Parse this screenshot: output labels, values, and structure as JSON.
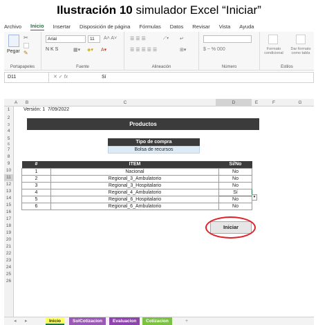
{
  "caption": {
    "bold": "Ilustración 10",
    "rest": " simulador Excel “Iniciar”"
  },
  "menu": [
    "Archivo",
    "Inicio",
    "Insertar",
    "Disposición de página",
    "Fórmulas",
    "Datos",
    "Revisar",
    "Vista",
    "Ayuda"
  ],
  "ribbon": {
    "paste_label": "Pegar",
    "font_name": "Arial",
    "font_size": "11",
    "font_format": "N K S",
    "number_format": "$ ~ % 000",
    "cond_format": "Formato condicional",
    "table_format": "Dar formato como tabla",
    "groups": [
      "Portapapeles",
      "Fuente",
      "Alineación",
      "Número",
      "Estilos"
    ]
  },
  "formula": {
    "cell": "D11",
    "fx": "fx",
    "value": "Sí"
  },
  "columns": [
    "A",
    "B",
    "C",
    "D",
    "E",
    "F",
    "G"
  ],
  "rows": [
    "1",
    "2",
    "3",
    "4",
    "5",
    "6",
    "7",
    "8",
    "9",
    "10",
    "11",
    "12",
    "13",
    "14",
    "15",
    "16",
    "17",
    "18",
    "19",
    "20",
    "21",
    "22",
    "23",
    "24",
    "25",
    "26"
  ],
  "version": {
    "label": "Versión: 1",
    "date": "7/09/2022"
  },
  "products_title": "Productos",
  "tipo": {
    "header": "Tipo de compra",
    "value": "Bolsa de recursos"
  },
  "table": {
    "headers": [
      "#",
      "ITEM",
      "Sí/No"
    ],
    "rows": [
      {
        "n": "1",
        "item": "Nacional",
        "v": "No"
      },
      {
        "n": "2",
        "item": "Regional_3_Ambulatorio",
        "v": "No"
      },
      {
        "n": "3",
        "item": "Regional_3_Hospitalario",
        "v": "No"
      },
      {
        "n": "4",
        "item": "Regional_4_Ambulatorio",
        "v": "Sí"
      },
      {
        "n": "5",
        "item": "Regional_6_Hospitalario",
        "v": "No"
      },
      {
        "n": "6",
        "item": "Regional_6_Ambulatorio",
        "v": "No"
      }
    ]
  },
  "iniciar_label": "Iniciar",
  "sheets": [
    {
      "name": "Inicio",
      "color": "#ffff66"
    },
    {
      "name": "SolCotizacion",
      "color": "#9b59b6"
    },
    {
      "name": "Evaluacion",
      "color": "#8e44ad"
    },
    {
      "name": "Cotizacion",
      "color": "#7cc242"
    }
  ],
  "add_sheet": "+"
}
